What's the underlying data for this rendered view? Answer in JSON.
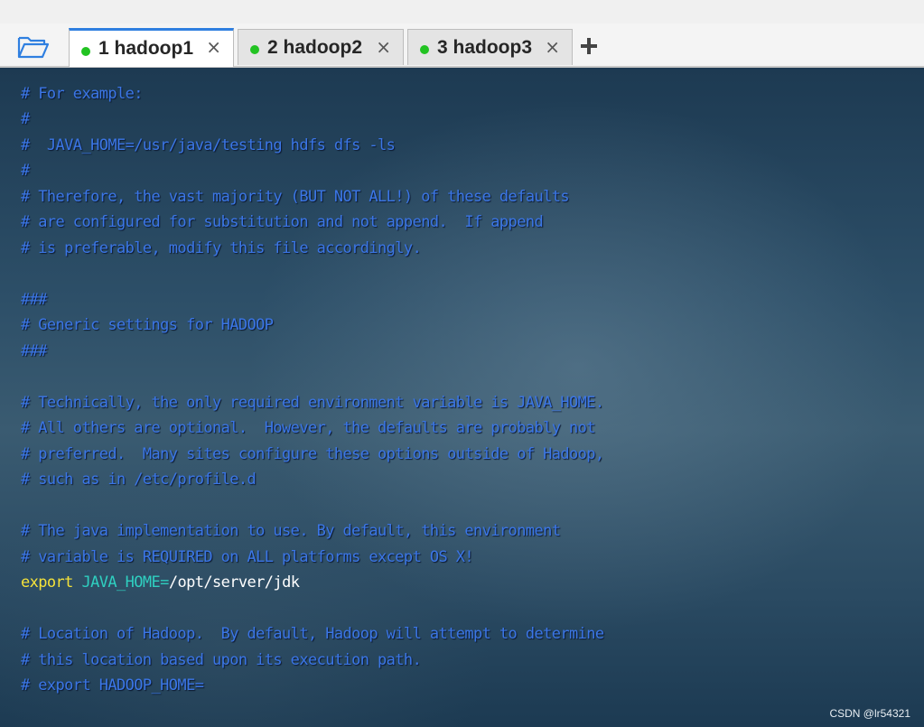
{
  "tabs": [
    {
      "label": "1 hadoop1",
      "active": true,
      "status_color": "#22c322"
    },
    {
      "label": "2 hadoop2",
      "active": false,
      "status_color": "#22c322"
    },
    {
      "label": "3 hadoop3",
      "active": false,
      "status_color": "#22c322"
    }
  ],
  "tab_close_glyph": "×",
  "icons": {
    "open_sessions": "folder-open-icon",
    "new_tab": "plus-icon"
  },
  "terminal": {
    "colors": {
      "comment": "#3b76e6",
      "keyword": "#f5e23a",
      "variable": "#2fcfc0",
      "text": "#ffffff"
    },
    "lines": [
      "# For example:",
      "#",
      "#  JAVA_HOME=/usr/java/testing hdfs dfs -ls",
      "#",
      "# Therefore, the vast majority (BUT NOT ALL!) of these defaults",
      "# are configured for substitution and not append.  If append",
      "# is preferable, modify this file accordingly.",
      "",
      "###",
      "# Generic settings for HADOOP",
      "###",
      "",
      "# Technically, the only required environment variable is JAVA_HOME.",
      "# All others are optional.  However, the defaults are probably not",
      "# preferred.  Many sites configure these options outside of Hadoop,",
      "# such as in /etc/profile.d",
      "",
      "# The java implementation to use. By default, this environment",
      "# variable is REQUIRED on ALL platforms except OS X!",
      "",
      "",
      "# Location of Hadoop.  By default, Hadoop will attempt to determine",
      "# this location based upon its execution path.",
      "# export HADOOP_HOME="
    ],
    "export_line": {
      "keyword": "export",
      "variable": "JAVA_HOME=",
      "value": "/opt/server/jdk"
    }
  },
  "watermark": "CSDN @lr54321"
}
